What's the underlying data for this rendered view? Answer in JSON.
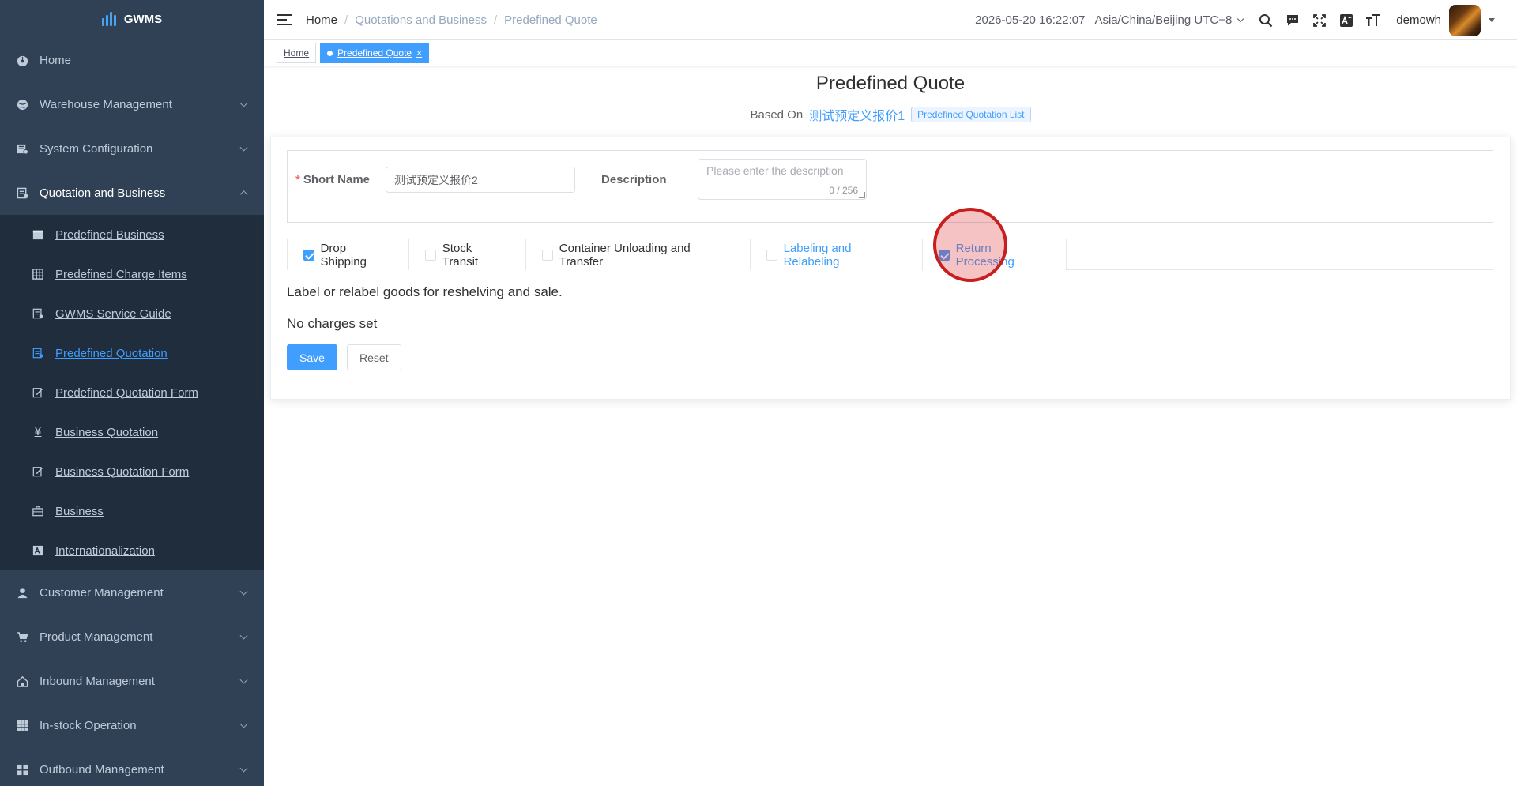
{
  "app": {
    "title": "GWMS"
  },
  "sidebar": {
    "items": [
      {
        "label": "Home",
        "icon": "dashboard-icon"
      },
      {
        "label": "Warehouse Management",
        "icon": "globe-icon"
      },
      {
        "label": "System Configuration",
        "icon": "config-icon"
      },
      {
        "label": "Quotation and Business",
        "icon": "quotation-icon"
      }
    ],
    "submenu": [
      {
        "label": "Predefined Business",
        "icon": "calendar-icon"
      },
      {
        "label": "Predefined Charge Items",
        "icon": "table-icon"
      },
      {
        "label": "GWMS Service Guide",
        "icon": "guide-icon"
      },
      {
        "label": "Predefined Quotation",
        "icon": "quotation-doc-icon"
      },
      {
        "label": "Predefined Quotation Form",
        "icon": "form-edit-icon"
      },
      {
        "label": "Business Quotation",
        "icon": "yen-icon"
      },
      {
        "label": "Business Quotation Form",
        "icon": "form-edit-icon"
      },
      {
        "label": "Business",
        "icon": "briefcase-icon"
      },
      {
        "label": "Internationalization",
        "icon": "translate-icon"
      }
    ],
    "items_after": [
      {
        "label": "Customer Management",
        "icon": "user-icon"
      },
      {
        "label": "Product Management",
        "icon": "cart-icon"
      },
      {
        "label": "Inbound Management",
        "icon": "house-icon"
      },
      {
        "label": "In-stock Operation",
        "icon": "grid-icon"
      },
      {
        "label": "Outbound Management",
        "icon": "apps-icon"
      }
    ]
  },
  "header": {
    "breadcrumb": [
      "Home",
      "Quotations and Business",
      "Predefined Quote"
    ],
    "datetime": "2026-05-20 16:22:07",
    "timezone": "Asia/China/Beijing UTC+8",
    "username": "demowh"
  },
  "tags": [
    {
      "label": "Home"
    },
    {
      "label": "Predefined Quote",
      "close": "×"
    }
  ],
  "page": {
    "title": "Predefined Quote",
    "based_on_label": "Based On",
    "based_on_value": "测试预定义报价1",
    "based_on_tag": "Predefined Quotation List"
  },
  "form": {
    "short_name_label": "Short Name",
    "required_mark": "*",
    "short_name_value": "测试预定义报价2",
    "description_label": "Description",
    "description_placeholder": "Please enter the description",
    "description_count": "0 / 256"
  },
  "tabs": [
    {
      "label": "Drop Shipping",
      "checked": true
    },
    {
      "label": "Stock Transit",
      "checked": false
    },
    {
      "label": "Container Unloading and Transfer",
      "checked": false
    },
    {
      "label": "Labeling and Relabeling",
      "checked": false,
      "active": true
    },
    {
      "label": "Return Processing",
      "checked": true
    }
  ],
  "content": {
    "description": "Label or relabel goods for reshelving and sale.",
    "charges_status": "No charges set"
  },
  "buttons": {
    "save": "Save",
    "reset": "Reset"
  },
  "colors": {
    "sidebar_bg": "#304156",
    "submenu_bg": "#1f2d3d",
    "accent": "#409eff",
    "click_marker": "#c81e1e"
  }
}
